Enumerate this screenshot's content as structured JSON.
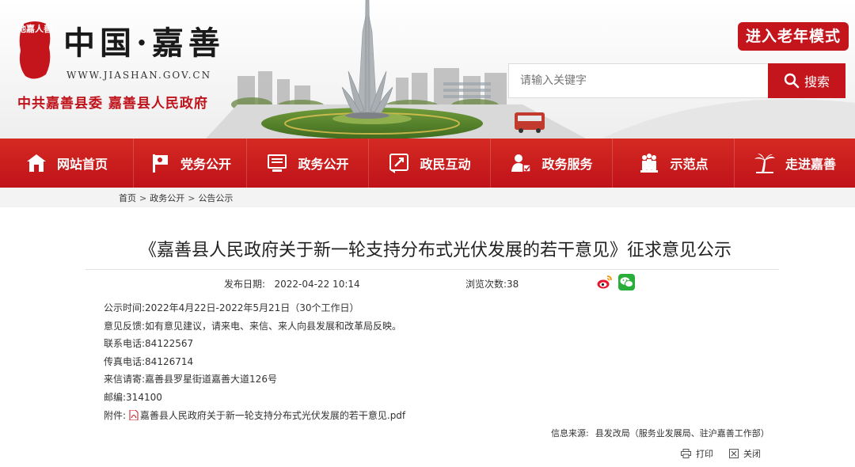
{
  "header": {
    "seal_text": "地嘉人善",
    "site_title": "中国·嘉善",
    "site_url": "WWW.JIASHAN.GOV.CN",
    "site_subtitle": "中共嘉善县委  嘉善县人民政府",
    "elderly_mode_label": "进入老年模式",
    "search": {
      "placeholder": "请输入关键字",
      "button_label": "搜索"
    }
  },
  "nav": {
    "items": [
      {
        "label": "网站首页",
        "icon": "home-icon"
      },
      {
        "label": "党务公开",
        "icon": "party-flag-icon"
      },
      {
        "label": "政务公开",
        "icon": "document-monitor-icon"
      },
      {
        "label": "政民互动",
        "icon": "interaction-icon"
      },
      {
        "label": "政务服务",
        "icon": "user-service-icon"
      },
      {
        "label": "示范点",
        "icon": "people-group-icon"
      },
      {
        "label": "走进嘉善",
        "icon": "palm-tree-icon"
      }
    ]
  },
  "breadcrumb": {
    "items": [
      "首页",
      "政务公开",
      "公告公示"
    ],
    "separator": ">"
  },
  "article": {
    "title": "《嘉善县人民政府关于新一轮支持分布式光伏发展的若干意见》征求意见公示",
    "publish_label": "发布日期:",
    "publish_date": "2022-04-22 10:14",
    "views_label": "浏览次数:",
    "views": "38",
    "share_icons": [
      "weibo-icon",
      "wechat-icon"
    ],
    "fields": [
      {
        "label": "公示时间:",
        "value": "2022年4月22日-2022年5月21日（30个工作日）"
      },
      {
        "label": "意见反馈:",
        "value": "如有意见建议，请来电、来信、来人向县发展和改革局反映。"
      },
      {
        "label": "联系电话:",
        "value": "84122567"
      },
      {
        "label": "传真电话:",
        "value": "84126714"
      },
      {
        "label": "来信请寄:",
        "value": "嘉善县罗星街道嘉善大道126号"
      },
      {
        "label": "邮编:",
        "value": "314100"
      }
    ],
    "attachment": {
      "label": "附件:",
      "file_name": "嘉善县人民政府关于新一轮支持分布式光伏发展的若干意见.pdf"
    },
    "source_label": "信息来源:",
    "source": "县发改局（服务业发展局、驻沪嘉善工作部）",
    "print_label": "打印",
    "close_label": "关闭"
  },
  "colors": {
    "brand_red": "#c4151c",
    "nav_red": "#c8161e",
    "breadcrumb_bg": "#f3f3f3"
  }
}
